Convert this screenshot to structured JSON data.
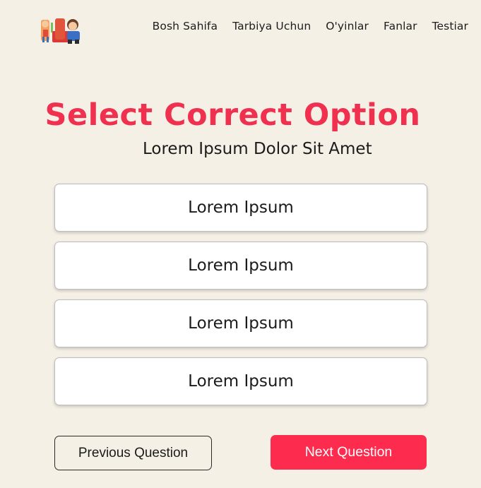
{
  "nav": {
    "items": [
      {
        "label": "Bosh Sahifa"
      },
      {
        "label": "Tarbiya Uchun"
      },
      {
        "label": "O'yinlar"
      },
      {
        "label": "Fanlar"
      },
      {
        "label": "Testiar"
      }
    ]
  },
  "quiz": {
    "title": "Select Correct Option",
    "question": "Lorem Ipsum Dolor Sit Amet",
    "options": [
      {
        "label": "Lorem Ipsum"
      },
      {
        "label": "Lorem Ipsum"
      },
      {
        "label": "Lorem Ipsum"
      },
      {
        "label": "Lorem Ipsum"
      }
    ]
  },
  "buttons": {
    "previous": "Previous Question",
    "next": "Next Question"
  },
  "colors": {
    "background": "#f5f0e6",
    "accent": "#fd2b4e",
    "title": "#f0304f"
  },
  "logo": {
    "icon": "kids-reading-logo"
  }
}
